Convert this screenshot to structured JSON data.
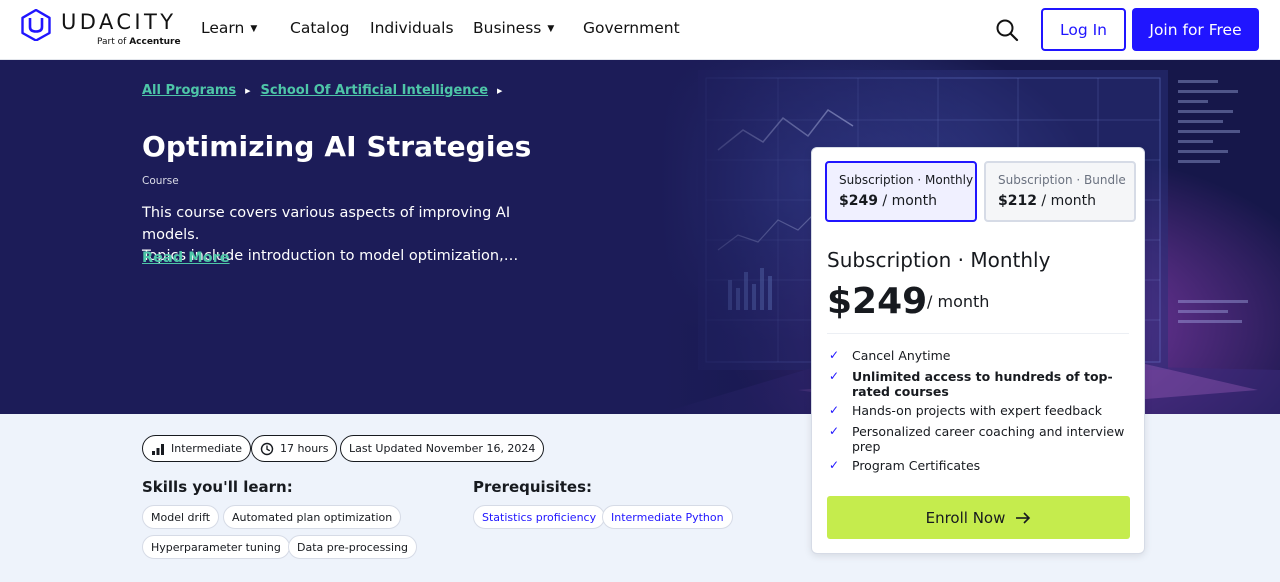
{
  "brand": {
    "name": "UDACITY",
    "tagline_prefix": "Part of",
    "tagline_company": "Accenture"
  },
  "nav": {
    "items": [
      {
        "label": "Learn",
        "dropdown": true
      },
      {
        "label": "Catalog",
        "dropdown": false
      },
      {
        "label": "Individuals",
        "dropdown": false
      },
      {
        "label": "Business",
        "dropdown": true
      },
      {
        "label": "Government",
        "dropdown": false
      }
    ],
    "login_label": "Log In",
    "join_label": "Join for Free",
    "search_icon": "search-icon"
  },
  "breadcrumb": {
    "items": [
      "All Programs",
      "School Of Artificial Intelligence"
    ]
  },
  "course": {
    "title": "Optimizing AI Strategies",
    "type": "Course",
    "description_line1": "This course covers various aspects of improving AI models.",
    "description_line2": "Topics include introduction to model optimization,…",
    "read_more": "Read More"
  },
  "meta": {
    "level": "Intermediate",
    "duration": "17 hours",
    "updated": "Last Updated November 16, 2024"
  },
  "skills": {
    "heading": "Skills you'll learn:",
    "items": [
      "Model drift",
      "Automated plan optimization",
      "Hyperparameter tuning",
      "Data pre-processing"
    ]
  },
  "prerequisites": {
    "heading": "Prerequisites:",
    "items": [
      "Statistics proficiency",
      "Intermediate Python"
    ]
  },
  "pricing": {
    "options": [
      {
        "name": "Subscription · Monthly",
        "price": "$249",
        "period": "/ month",
        "selected": true
      },
      {
        "name": "Subscription · Bundle",
        "price": "$212",
        "period": "/ month",
        "selected": false
      }
    ],
    "selected_name": "Subscription · Monthly",
    "selected_price": "$249",
    "selected_period": "/ month",
    "features": [
      {
        "text": "Cancel Anytime",
        "bold": false
      },
      {
        "text": "Unlimited access to hundreds of top-rated courses",
        "bold": true
      },
      {
        "text": "Hands-on projects with expert feedback",
        "bold": false
      },
      {
        "text": "Personalized career coaching and interview prep",
        "bold": false
      },
      {
        "text": "Program Certificates",
        "bold": false
      }
    ],
    "enroll_label": "Enroll Now"
  },
  "colors": {
    "brand_blue": "#2015ff",
    "hero_bg": "#1c1c58",
    "link_teal": "#4ec6a8",
    "enroll_green": "#c5ec4d",
    "page_bg": "#eef3fb"
  }
}
